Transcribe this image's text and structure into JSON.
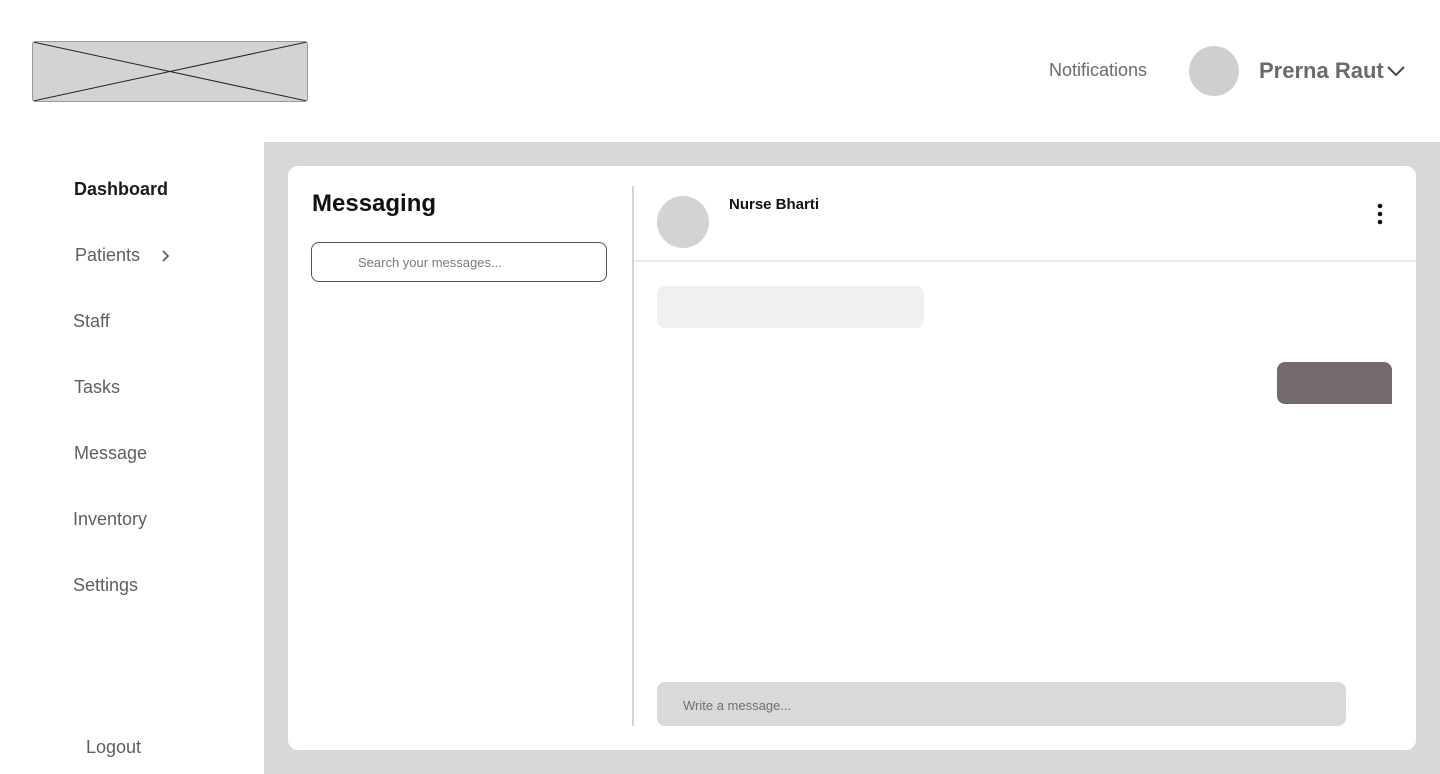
{
  "header": {
    "logo_icon": "image-placeholder-icon",
    "notifications_label": "Notifications",
    "user_name": "Prerna Raut",
    "user_menu_icon": "chevron-down-icon"
  },
  "sidebar": {
    "items": [
      {
        "label": "Dashboard",
        "active": true
      },
      {
        "label": "Patients",
        "has_submenu": true
      },
      {
        "label": "Staff"
      },
      {
        "label": "Tasks"
      },
      {
        "label": "Message"
      },
      {
        "label": "Inventory"
      },
      {
        "label": "Settings"
      }
    ],
    "logout_label": "Logout"
  },
  "messaging": {
    "title": "Messaging",
    "search_placeholder": "Search your messages..."
  },
  "chat": {
    "contact_name": "Nurse Bharti",
    "menu_icon": "more-vertical-icon",
    "composer_placeholder": "Write a message..."
  },
  "colors": {
    "main_background": "#d9d8d8",
    "card": "#ffffff",
    "outgoing_bubble": "#736a6d",
    "incoming_bubble": "#f0f0f0",
    "composer": "#d9d9d9"
  }
}
